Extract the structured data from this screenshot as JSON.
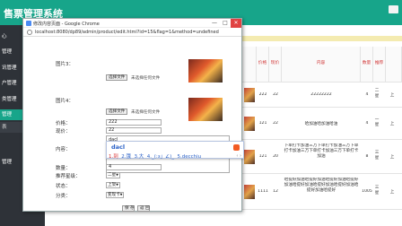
{
  "app": {
    "title": "售票管理系统"
  },
  "sidebar": {
    "items": [
      {
        "label": "心",
        "active": false
      },
      {
        "label": "管理",
        "active": false
      },
      {
        "label": "讯管理",
        "active": false
      },
      {
        "label": "户管理",
        "active": false
      },
      {
        "label": "类管理",
        "active": false
      },
      {
        "label": "管理",
        "active": true
      },
      {
        "label": "表",
        "active": false,
        "sub": true
      },
      {
        "label": "",
        "active": false
      },
      {
        "label": "管理",
        "active": false
      },
      {
        "label": "",
        "active": false
      }
    ]
  },
  "table": {
    "headers": [
      "价格",
      "现价",
      "内容",
      "数量",
      "推荐"
    ],
    "rows": [
      {
        "price": "222",
        "cur": "22",
        "content": "22222222",
        "qty": "4",
        "flag": "二星",
        "flag2": "上"
      },
      {
        "price": "121",
        "cur": "22",
        "content": "哈加油哈加油哈油",
        "qty": "4",
        "flag": "一星",
        "flag2": "上"
      },
      {
        "price": "121",
        "cur": "20",
        "content": "下单打卡加油三万下单打卡加油三万下单打卡加油三万下单打卡加油三万下单打卡加油",
        "qty": "8",
        "flag": "三星",
        "flag2": "上"
      },
      {
        "price": "1111",
        "cur": "12",
        "content": "哈提好加油哈提好加油哈提好加油哈提好加油哈提好加油哈提好加油哈提好加油哈提好加油哈提好",
        "qty": "1005",
        "flag": "三星",
        "flag2": "上"
      }
    ]
  },
  "browser": {
    "title": "修改内容页面 - Google Chrome",
    "url": "localhost:8080/dp89/admin/product/edit.html?id=15&flag=1&method=undefined",
    "controls": {
      "min": "—",
      "max": "□",
      "close": "✕"
    }
  },
  "form": {
    "image3_label": "图片3：",
    "image4_label": "图片4：",
    "choose_file": "选择文件",
    "no_file": "未选择任何文件",
    "price_label": "价格：",
    "price_value": "222",
    "cur_label": "现价：",
    "cur_value": "22",
    "content_label": "内容：",
    "content_value": "dacl",
    "qty_label": "数量：",
    "qty_value": "4",
    "recommend_label": "推荐星级：",
    "recommend_value": "二星",
    "status_label": "状态：",
    "status_value": "上架",
    "category_label": "分类：",
    "category_value": "变现卡",
    "save_label": "保 存",
    "back_label": "返 回"
  },
  "ime": {
    "pinyin": "dacl",
    "candidates": [
      {
        "label": "1.到",
        "first": true
      },
      {
        "label": "2.饿",
        "first": false
      },
      {
        "label": "3.大",
        "first": false
      },
      {
        "label": "4._(:з」∠)_",
        "first": false
      },
      {
        "label": "5.decchiu",
        "first": false
      }
    ],
    "nav": "‹ ›"
  },
  "colors": {
    "brand": "#17a58a",
    "sidebar": "#2e3238",
    "accent_red": "#d23b3b"
  }
}
